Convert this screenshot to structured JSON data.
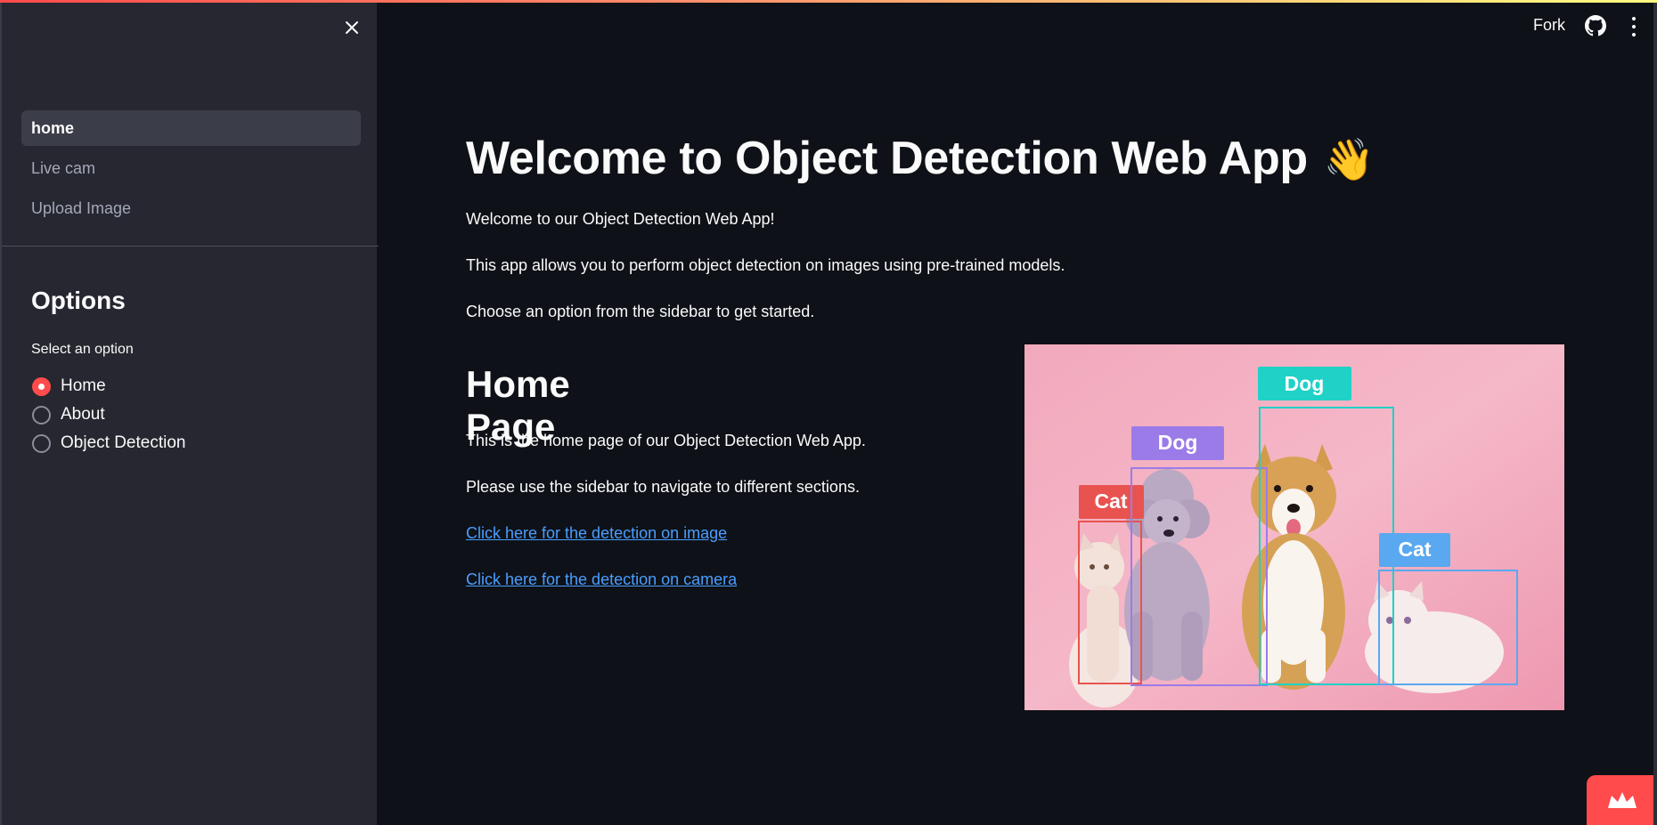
{
  "sidebar": {
    "nav": [
      {
        "label": "home",
        "active": true
      },
      {
        "label": "Live cam",
        "active": false
      },
      {
        "label": "Upload Image",
        "active": false
      }
    ],
    "options_title": "Options",
    "select_label": "Select an option",
    "radio_options": [
      {
        "label": "Home",
        "selected": true
      },
      {
        "label": "About",
        "selected": false
      },
      {
        "label": "Object Detection",
        "selected": false
      }
    ]
  },
  "header": {
    "fork_label": "Fork",
    "github_icon": "github-icon",
    "menu_icon": "kebab-menu-icon"
  },
  "main": {
    "title": "Welcome to Object Detection Web App",
    "title_emoji": "👋",
    "intro": [
      "Welcome to our Object Detection Web App!",
      "This app allows you to perform object detection on images using pre-trained models.",
      "Choose an option from the sidebar to get started."
    ],
    "home_title": "Home Page",
    "home_paragraphs": [
      "This is the home page of our Object Detection Web App.",
      "Please use the sidebar to navigate to different sections."
    ],
    "links": [
      "Click here for the detection on image",
      "Click here for the detection on camera"
    ],
    "image": {
      "labels": [
        "Cat",
        "Dog",
        "Dog",
        "Cat"
      ]
    }
  },
  "colors": {
    "accent": "#ff4b4b",
    "background": "#0e1117",
    "sidebar": "#262730",
    "link": "#4a9eff",
    "cat_red_box": "#e8534f",
    "dog_purple_box": "#9b7be8",
    "dog_teal_box": "#1fd1c6",
    "cat_blue_box": "#5aa8ef"
  }
}
